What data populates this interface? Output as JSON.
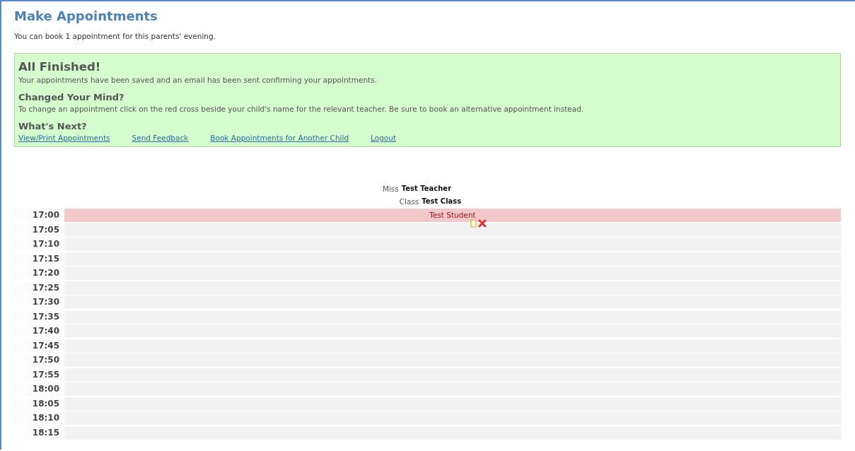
{
  "title": "Make Appointments",
  "intro": "You can book 1 appointment for this parents' evening.",
  "notice": {
    "heading": "All Finished!",
    "message": "Your appointments have been saved and an email has been sent confirming your appointments.",
    "sections": [
      {
        "heading": "Changed Your Mind?",
        "text": "To change an appointment click on the red cross beside your child's name for the relevant teacher. Be sure to book an alternative appointment instead."
      },
      {
        "heading": "What's Next?",
        "links": [
          "View/Print Appointments",
          "Send Feedback",
          "Book Appointments for Another Child",
          "Logout"
        ]
      }
    ]
  },
  "teacher": {
    "title": "Miss",
    "name": "Test Teacher",
    "class_label": "Class",
    "class_name": "Test Class"
  },
  "slots": [
    {
      "time": "17:00",
      "kind": "booked",
      "student": "Test Student"
    },
    {
      "time": "17:05",
      "kind": "free"
    },
    {
      "time": "17:10",
      "kind": "free"
    },
    {
      "time": "17:15",
      "kind": "free"
    },
    {
      "time": "17:20",
      "kind": "free"
    },
    {
      "time": "17:25",
      "kind": "free"
    },
    {
      "time": "17:30",
      "kind": "free"
    },
    {
      "time": "17:35",
      "kind": "free"
    },
    {
      "time": "17:40",
      "kind": "free"
    },
    {
      "time": "17:45",
      "kind": "free"
    },
    {
      "time": "17:50",
      "kind": "free"
    },
    {
      "time": "17:55",
      "kind": "free"
    },
    {
      "time": "18:00",
      "kind": "free"
    },
    {
      "time": "18:05",
      "kind": "free"
    },
    {
      "time": "18:10",
      "kind": "free"
    },
    {
      "time": "18:15",
      "kind": "free"
    }
  ]
}
